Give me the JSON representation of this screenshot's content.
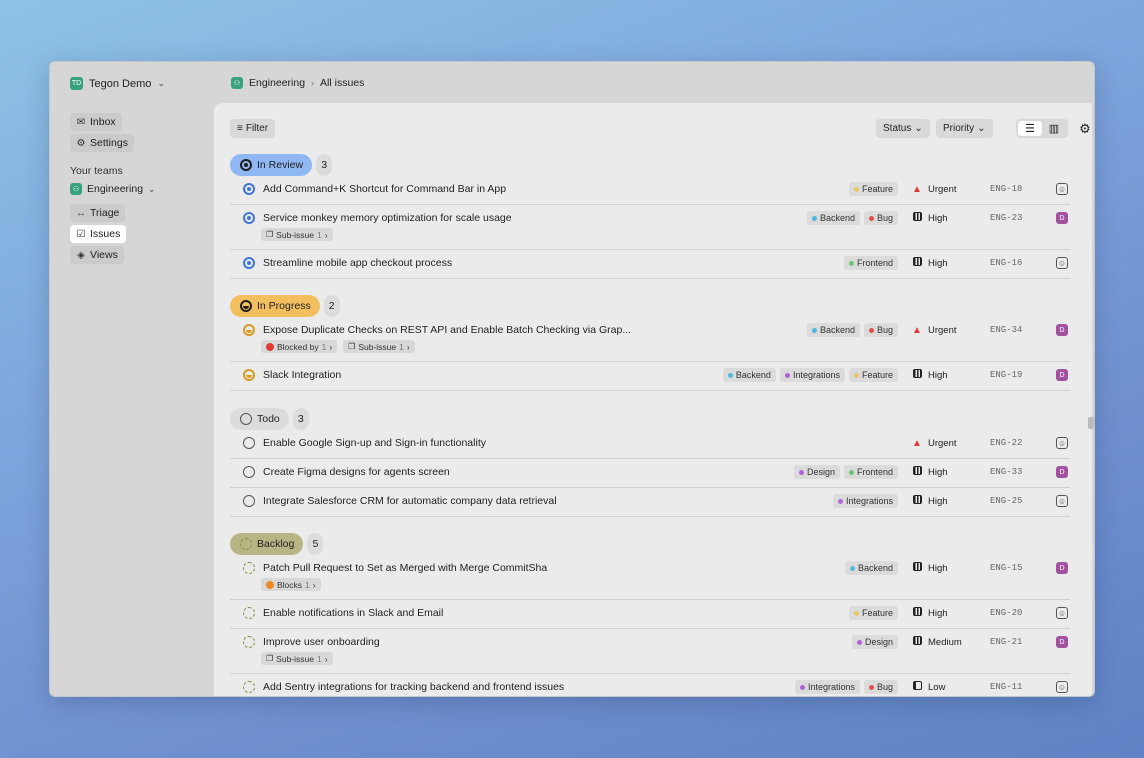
{
  "workspace": {
    "initials": "TD",
    "name": "Tegon Demo"
  },
  "sidebar": {
    "nav": [
      {
        "label": "Inbox",
        "icon": "inbox-icon"
      },
      {
        "label": "Settings",
        "icon": "gear-icon"
      }
    ],
    "teams_label": "Your teams",
    "team": {
      "name": "Engineering"
    },
    "team_nav": [
      {
        "label": "Triage",
        "icon": "triage-icon"
      },
      {
        "label": "Issues",
        "icon": "issues-icon",
        "active": true
      },
      {
        "label": "Views",
        "icon": "layers-icon"
      }
    ]
  },
  "breadcrumb": {
    "team": "Engineering",
    "page": "All issues"
  },
  "toolbar": {
    "filter": "Filter",
    "status": "Status",
    "priority": "Priority"
  },
  "groups": [
    {
      "name": "In Review",
      "count": "3",
      "state": "review",
      "color": "#8fb7f3",
      "issues": [
        {
          "title": "Add Command+K Shortcut for Command Bar in App",
          "labels": [
            {
              "name": "Feature",
              "color": "#e9c46a"
            }
          ],
          "priority": "Urgent",
          "pri_icon": "urgent",
          "key": "ENG-18",
          "assignee": ""
        },
        {
          "title": "Service monkey memory optimization for scale usage",
          "labels": [
            {
              "name": "Backend",
              "color": "#4fb8e0"
            },
            {
              "name": "Bug",
              "color": "#e94b4b"
            }
          ],
          "priority": "High",
          "pri_icon": "high",
          "key": "ENG-23",
          "assignee": "D",
          "chips": [
            {
              "icon": "subissue",
              "text": "Sub-issue",
              "n": "1"
            }
          ]
        },
        {
          "title": "Streamline mobile app checkout process",
          "labels": [
            {
              "name": "Frontend",
              "color": "#6fc36f"
            }
          ],
          "priority": "High",
          "pri_icon": "high",
          "key": "ENG-16",
          "assignee": ""
        }
      ]
    },
    {
      "name": "In Progress",
      "count": "2",
      "state": "prog",
      "color": "#f3bf5e",
      "issues": [
        {
          "title": "Expose Duplicate Checks on REST API and Enable Batch Checking via Grap...",
          "labels": [
            {
              "name": "Backend",
              "color": "#4fb8e0"
            },
            {
              "name": "Bug",
              "color": "#e94b4b"
            }
          ],
          "priority": "Urgent",
          "pri_icon": "urgent",
          "key": "ENG-34",
          "assignee": "D",
          "chips": [
            {
              "icon": "blocked",
              "text": "Blocked by",
              "n": "1"
            },
            {
              "icon": "subissue",
              "text": "Sub-issue",
              "n": "1"
            }
          ]
        },
        {
          "title": "Slack Integration",
          "labels": [
            {
              "name": "Backend",
              "color": "#4fb8e0"
            },
            {
              "name": "Integrations",
              "color": "#b063d6"
            },
            {
              "name": "Feature",
              "color": "#e9c46a"
            }
          ],
          "priority": "High",
          "pri_icon": "high",
          "key": "ENG-19",
          "assignee": "D"
        }
      ]
    },
    {
      "name": "Todo",
      "count": "3",
      "state": "todo",
      "color": "#dcdcdc",
      "issues": [
        {
          "title": "Enable Google Sign-up and Sign-in functionality",
          "labels": [],
          "priority": "Urgent",
          "pri_icon": "urgent",
          "key": "ENG-22",
          "assignee": ""
        },
        {
          "title": "Create Figma designs for agents screen",
          "labels": [
            {
              "name": "Design",
              "color": "#b063d6"
            },
            {
              "name": "Frontend",
              "color": "#6fc36f"
            }
          ],
          "priority": "High",
          "pri_icon": "high",
          "key": "ENG-33",
          "assignee": "D"
        },
        {
          "title": "Integrate Salesforce CRM for automatic company data retrieval",
          "labels": [
            {
              "name": "Integrations",
              "color": "#b063d6"
            }
          ],
          "priority": "High",
          "pri_icon": "high",
          "key": "ENG-25",
          "assignee": ""
        }
      ]
    },
    {
      "name": "Backlog",
      "count": "5",
      "state": "back",
      "color": "#b8b585",
      "issues": [
        {
          "title": "Patch Pull Request to Set as Merged with Merge CommitSha",
          "labels": [
            {
              "name": "Backend",
              "color": "#4fb8e0"
            }
          ],
          "priority": "High",
          "pri_icon": "high",
          "key": "ENG-15",
          "assignee": "D",
          "chips": [
            {
              "icon": "blocks",
              "text": "Blocks",
              "n": "1"
            }
          ]
        },
        {
          "title": "Enable notifications in Slack and Email",
          "labels": [
            {
              "name": "Feature",
              "color": "#e9c46a"
            }
          ],
          "priority": "High",
          "pri_icon": "high",
          "key": "ENG-20",
          "assignee": ""
        },
        {
          "title": "Improve user onboarding",
          "labels": [
            {
              "name": "Design",
              "color": "#b063d6"
            }
          ],
          "priority": "Medium",
          "pri_icon": "medium",
          "key": "ENG-21",
          "assignee": "D",
          "chips": [
            {
              "icon": "subissue",
              "text": "Sub-issue",
              "n": "1"
            }
          ]
        },
        {
          "title": "Add Sentry integrations for tracking backend and frontend issues",
          "labels": [
            {
              "name": "Integrations",
              "color": "#b063d6"
            },
            {
              "name": "Bug",
              "color": "#e94b4b"
            }
          ],
          "priority": "Low",
          "pri_icon": "low",
          "key": "ENG-11",
          "assignee": ""
        }
      ]
    }
  ]
}
